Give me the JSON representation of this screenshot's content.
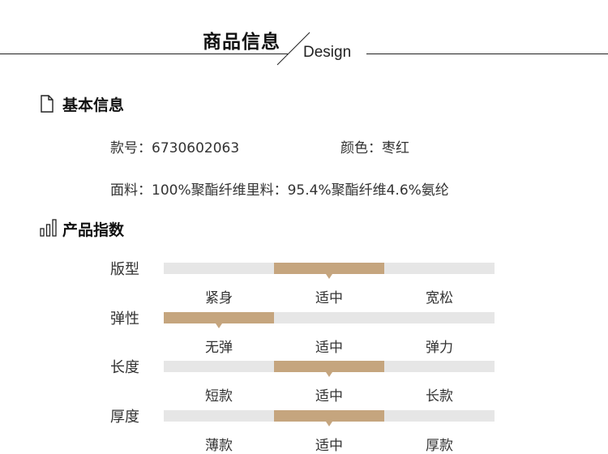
{
  "header": {
    "title": "商品信息",
    "subtitle": "Design"
  },
  "basic_info": {
    "title": "基本信息",
    "style_no": "款号：6730602063",
    "color": "颜色：枣红",
    "fabric": "面料：100%聚酯纤维里料：95.4%聚酯纤维4.6%氨纶"
  },
  "indices": {
    "title": "产品指数",
    "accent_color": "#c5a57e",
    "track_color": "#e6e6e6",
    "items": [
      {
        "label": "版型",
        "options": [
          "紧身",
          "适中",
          "宽松"
        ],
        "selected_index": 1
      },
      {
        "label": "弹性",
        "options": [
          "无弹",
          "适中",
          "弹力"
        ],
        "selected_index": 0
      },
      {
        "label": "长度",
        "options": [
          "短款",
          "适中",
          "长款"
        ],
        "selected_index": 1
      },
      {
        "label": "厚度",
        "options": [
          "薄款",
          "适中",
          "厚款"
        ],
        "selected_index": 1
      }
    ]
  }
}
